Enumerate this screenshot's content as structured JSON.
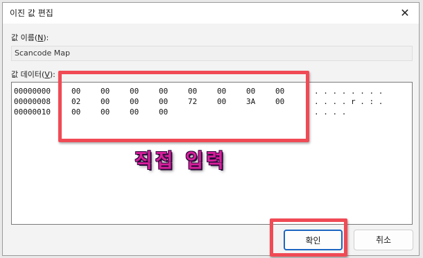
{
  "window": {
    "title": "이진 값 편집",
    "close_glyph": "✕"
  },
  "value_name": {
    "label_prefix": "값 이름(",
    "label_key": "N",
    "label_suffix": "):",
    "value": "Scancode Map"
  },
  "value_data": {
    "label_prefix": "값 데이터(",
    "label_key": "V",
    "label_suffix": "):",
    "rows": [
      {
        "offset": "00000000",
        "bytes": [
          "00",
          "00",
          "00",
          "00",
          "00",
          "00",
          "00",
          "00"
        ],
        "ascii": ". . . . . . . ."
      },
      {
        "offset": "00000008",
        "bytes": [
          "02",
          "00",
          "00",
          "00",
          "72",
          "00",
          "3A",
          "00"
        ],
        "ascii": ". . . . r . : ."
      },
      {
        "offset": "00000010",
        "bytes": [
          "00",
          "00",
          "00",
          "00"
        ],
        "ascii": ". . . ."
      }
    ]
  },
  "annotation": {
    "text": "직접 입력",
    "box_color": "#f04a55",
    "text_color": "#d81f9b"
  },
  "buttons": {
    "ok_label": "확인",
    "cancel_label": "취소"
  },
  "colors": {
    "accent": "#1a66c2"
  }
}
